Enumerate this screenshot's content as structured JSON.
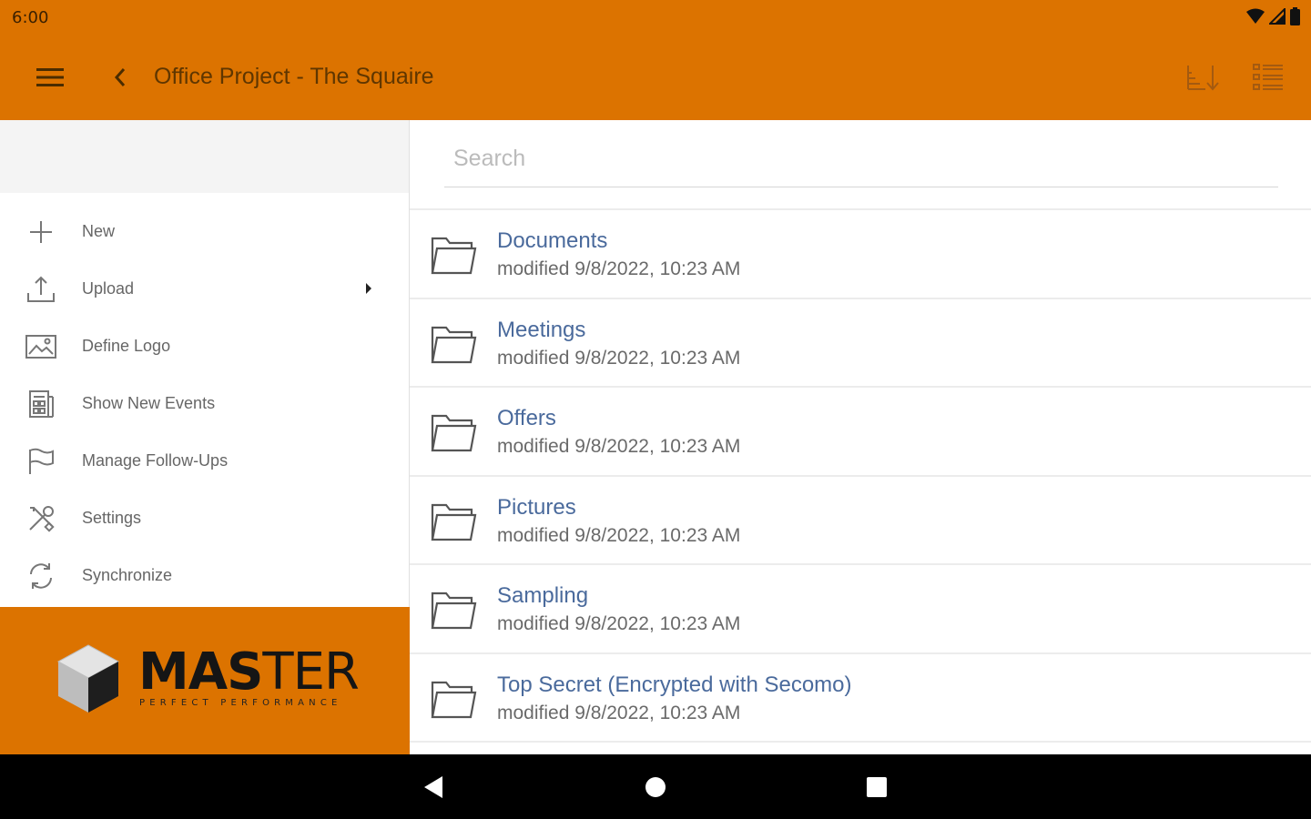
{
  "status_bar": {
    "time": "6:00",
    "icons": [
      "wifi-icon",
      "signal-icon",
      "battery-icon"
    ]
  },
  "app_bar": {
    "title": "Office Project - The Squaire",
    "icons": {
      "menu": "hamburger-menu-icon",
      "back": "chevron-left-icon",
      "sort": "sort-icon",
      "view": "list-view-icon"
    }
  },
  "drawer": {
    "items": [
      {
        "label": "New",
        "icon": "plus-icon"
      },
      {
        "label": "Upload",
        "icon": "upload-icon",
        "has_submenu": true
      },
      {
        "label": "Define Logo",
        "icon": "image-icon"
      },
      {
        "label": "Show New Events",
        "icon": "events-icon"
      },
      {
        "label": "Manage Follow-Ups",
        "icon": "flag-icon"
      },
      {
        "label": "Settings",
        "icon": "settings-tools-icon"
      },
      {
        "label": "Synchronize",
        "icon": "sync-icon"
      }
    ],
    "brand": {
      "name_bold": "MAS",
      "name_light": "TER",
      "tagline": "PERFECT PERFORMANCE"
    }
  },
  "search": {
    "placeholder": "Search",
    "value": ""
  },
  "files": [
    {
      "name": "Documents",
      "modified": "modified 9/8/2022, 10:23 AM",
      "icon": "folder-icon"
    },
    {
      "name": "Meetings",
      "modified": "modified 9/8/2022, 10:23 AM",
      "icon": "folder-icon"
    },
    {
      "name": "Offers",
      "modified": "modified 9/8/2022, 10:23 AM",
      "icon": "folder-icon"
    },
    {
      "name": "Pictures",
      "modified": "modified 9/8/2022, 10:23 AM",
      "icon": "folder-icon"
    },
    {
      "name": "Sampling",
      "modified": "modified 9/8/2022, 10:23 AM",
      "icon": "folder-icon"
    },
    {
      "name": "Top Secret (Encrypted with Secomo)",
      "modified": "modified 9/8/2022, 10:23 AM",
      "icon": "folder-icon"
    }
  ],
  "nav_bar": {
    "icons": [
      "back-triangle-icon",
      "home-circle-icon",
      "recents-square-icon"
    ]
  },
  "colors": {
    "accent": "#DC7300",
    "file_name": "#4A6A9C",
    "nav_bar": "#000000"
  }
}
